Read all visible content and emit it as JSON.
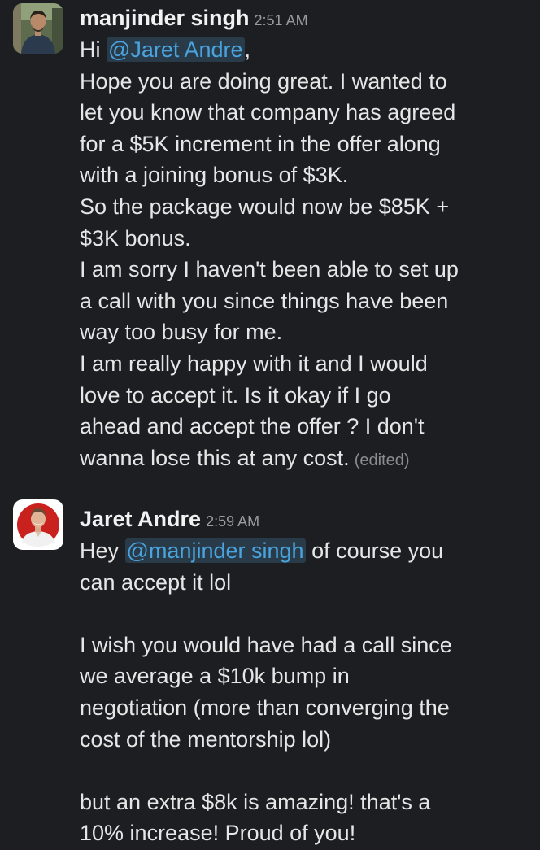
{
  "messages": [
    {
      "author": "manjinder singh",
      "time": "2:51 AM",
      "greeting_prefix": "Hi ",
      "mention": "@Jaret Andre",
      "greeting_suffix": ",",
      "lines": [
        "Hope you are doing great. I wanted to",
        "let you know that company has agreed",
        "for a $5K increment in the offer along",
        "with a joining bonus of $3K.",
        "So the package would now be $85K +",
        "$3K bonus.",
        "I am sorry I haven't been able to set up",
        "a call with you since things have been",
        "way too busy for me.",
        "I am really happy with it and I would",
        "love to accept it.  Is it okay if I go",
        "ahead and accept the offer ? I don't"
      ],
      "last_line": "wanna lose this at any cost.",
      "edited_label": "(edited)"
    },
    {
      "author": "Jaret Andre",
      "time": "2:59 AM",
      "greeting_prefix": "Hey ",
      "mention": "@manjinder singh",
      "greeting_suffix": " of course you",
      "lines": [
        "can accept it lol",
        "",
        "I wish you would have had a call since",
        "we average a $10k bump in",
        "negotiation (more than converging the",
        "cost of the mentorship lol)",
        "",
        "but an extra $8k is amazing! that's a",
        "10% increase! Proud of you!"
      ]
    }
  ],
  "colors": {
    "background": "#1d1e22",
    "text": "#e6e6e6",
    "mention_text": "#4aa3dd",
    "mention_bg": "#293a49",
    "muted": "#9a9b9e"
  }
}
